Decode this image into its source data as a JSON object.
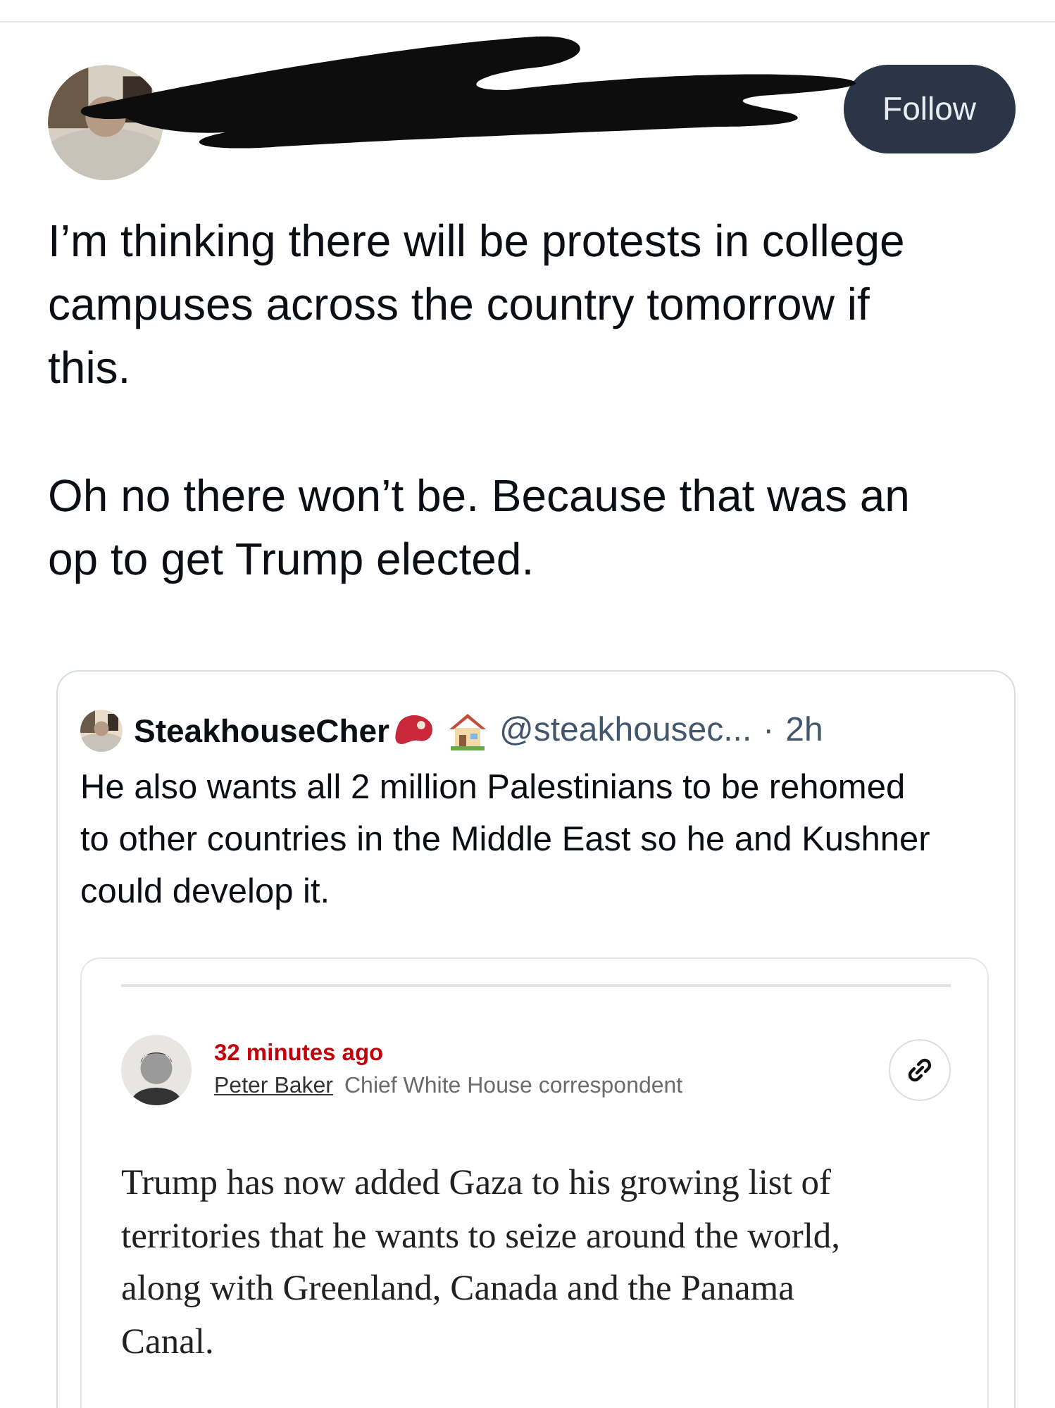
{
  "post": {
    "author": {
      "redacted": true
    },
    "follow_button": "Follow",
    "paragraphs": [
      "I’m thinking there will be protests in college campuses across the country tomorrow if this.",
      "Oh no there won’t be. Because that was an op to get Trump elected."
    ],
    "quote": {
      "display_name": "SteakhouseCher",
      "handle": "@steakhousec...",
      "separator": "·",
      "time": "2h",
      "text": "He also wants all 2 million Palestinians to be rehomed to other countries in the Middle East so he and Kushner could develop it.",
      "embed": {
        "time": "32 minutes ago",
        "author": "Peter Baker",
        "role": "Chief White House correspondent",
        "body": "Trump has now added Gaza to his growing list of territories that he wants to seize around the world, along with Greenland, Canada and the Panama Canal."
      }
    }
  }
}
